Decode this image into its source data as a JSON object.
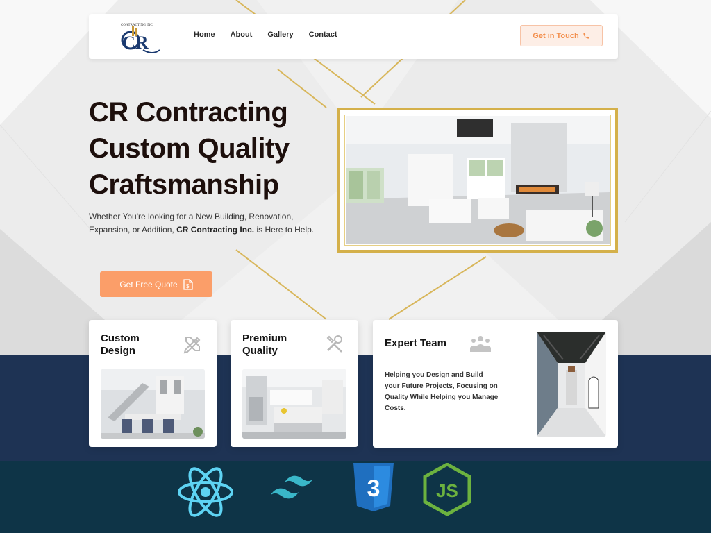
{
  "brand": {
    "logo_initials": "CR",
    "logo_tagline": "CONTRACTING INC"
  },
  "nav": {
    "links": [
      "Home",
      "About",
      "Gallery",
      "Contact"
    ],
    "cta_label": "Get in Touch"
  },
  "hero": {
    "title_lines": [
      "CR Contracting",
      "Custom Quality",
      "Craftsmanship"
    ],
    "subtitle_before": "Whether You're looking for a New Building, Renovation, Expansion, or Addition, ",
    "subtitle_strong": "CR Contracting Inc.",
    "subtitle_after": " is Here to Help.",
    "quote_button": "Get Free Quote"
  },
  "features": [
    {
      "title": "Custom Design",
      "icon": "design-tools-icon"
    },
    {
      "title": "Premium Quality",
      "icon": "tools-icon"
    },
    {
      "title": "Expert Team",
      "icon": "team-icon",
      "description": "Helping you Design and Build your Future Projects, Focusing on Quality While Helping you Manage Costs."
    }
  ],
  "tech_stack": [
    "react-icon",
    "tailwind-icon",
    "css3-icon",
    "nodejs-icon"
  ],
  "colors": {
    "accent": "#fb9e69",
    "navy": "#1e3354",
    "gold": "#d4b04a",
    "footer": "#0e3447"
  }
}
